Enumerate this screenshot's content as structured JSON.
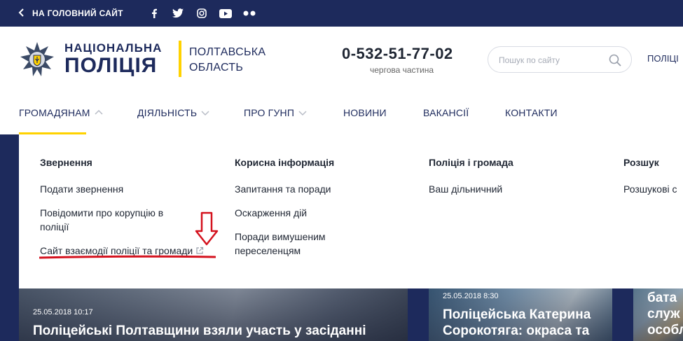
{
  "topbar": {
    "back_label": "НА ГОЛОВНИЙ САЙТ",
    "socials": [
      "facebook-icon",
      "twitter-icon",
      "instagram-icon",
      "youtube-icon",
      "flickr-icon"
    ]
  },
  "header": {
    "logo_line1": "НАЦІОНАЛЬНА",
    "logo_line2": "ПОЛІЦІЯ",
    "region_line1": "ПОЛТАВСЬКА",
    "region_line2": "ОБЛАСТЬ",
    "phone": "0-532-51-77-02",
    "phone_caption": "чергова частина",
    "search_placeholder": "Пошук по сайту",
    "right_text": "ПОЛІЦІ"
  },
  "nav": {
    "items": [
      {
        "label": "ГРОМАДЯНАМ"
      },
      {
        "label": "ДІЯЛЬНІСТЬ"
      },
      {
        "label": "ПРО ГУНП"
      },
      {
        "label": "НОВИНИ"
      },
      {
        "label": "ВАКАНСІЇ"
      },
      {
        "label": "КОНТАКТИ"
      }
    ]
  },
  "dropdown": {
    "columns": [
      {
        "title": "Звернення",
        "links": [
          "Подати звернення",
          "Повідомити про корупцію в поліції",
          "Сайт взаємодії поліції та громади"
        ]
      },
      {
        "title": "Корисна інформація",
        "links": [
          "Запитання та поради",
          "Оскарження дій",
          "Поради вимушеним переселенцям"
        ]
      },
      {
        "title": "Поліція і громада",
        "links": [
          "Ваш дільничний"
        ]
      },
      {
        "title": "Розшук",
        "links": [
          "Розшукові с"
        ]
      }
    ]
  },
  "news": [
    {
      "date": "25.05.2018 10:17",
      "title": "Поліцейські Полтавщини взяли участь у засіданні"
    },
    {
      "date": "25.05.2018 8:30",
      "title_line1": "Поліцейська Катерина",
      "title_line2": "Сорокотяга: окраса та"
    },
    {
      "title_line1": "бата",
      "title_line2": "служ",
      "title_line3": "особл"
    }
  ],
  "colors": {
    "navy": "#1d2a5c",
    "accent_yellow": "#ffd200",
    "annotation_red": "#d4121e"
  }
}
